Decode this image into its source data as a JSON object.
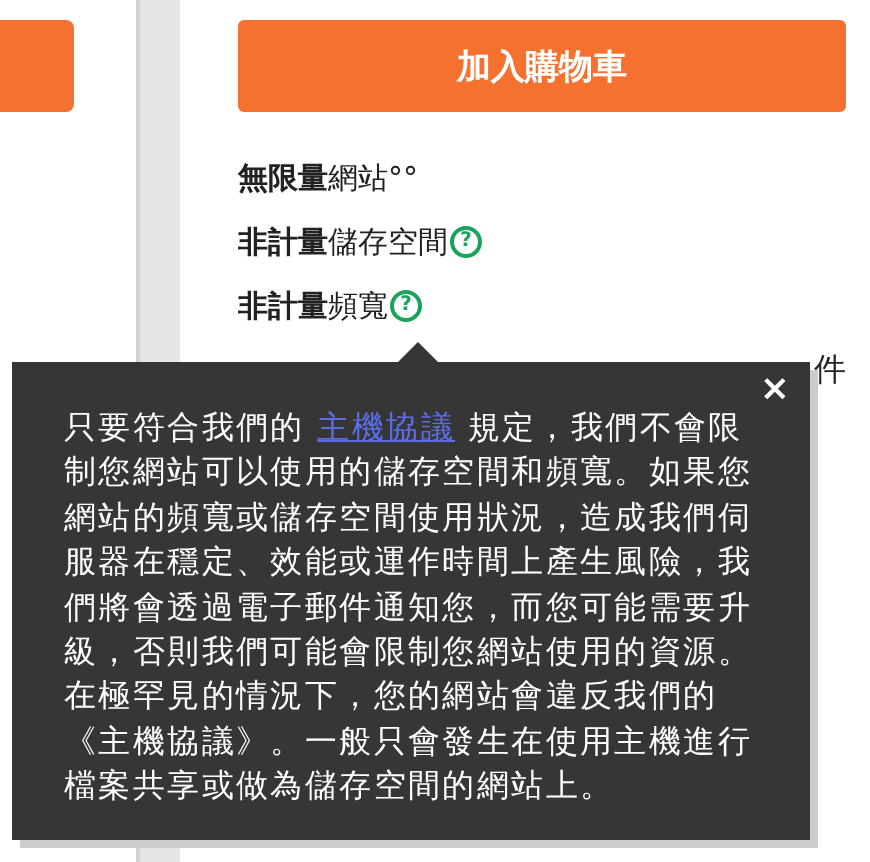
{
  "product": {
    "button": "加入購物車",
    "features": [
      {
        "text": "**無限量**網站°°"
      },
      {
        "text": "**非計量**儲存空間",
        "help": "?"
      },
      {
        "text": "**非計量**頻寬",
        "help": "?"
      }
    ],
    "fragment": "件"
  },
  "tooltip": {
    "close": "×",
    "text_before": "只要符合我們的 ",
    "link": "主機協議",
    "text_after": " 規定，我們不會限制您網站可以使用的儲存空間和頻寬。如果您網站的頻寬或儲存空間使用狀況，造成我們伺服器在穩定、效能或運作時間上產生風險，我們將會透過電子郵件通知您，而您可能需要升級，否則我們可能會限制您網站使用的資源。在極罕見的情況下，您的網站會違反我們的《主機協議》。一般只會發生在使用主機進行檔案共享或做為儲存空間的網站上。"
  }
}
